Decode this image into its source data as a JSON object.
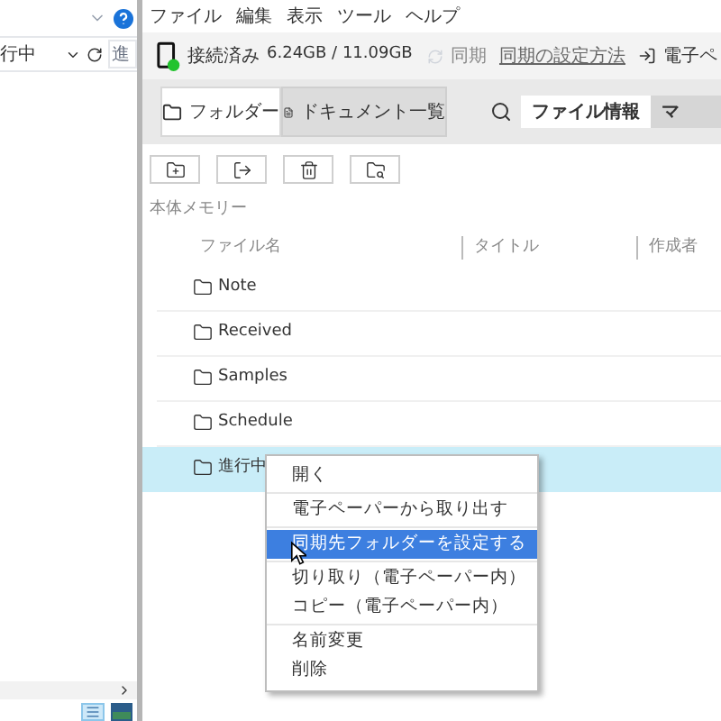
{
  "left_window": {
    "field_value": "行中",
    "input_placeholder": "進"
  },
  "menu_bar": [
    "ファイル",
    "編集",
    "表示",
    "ツール",
    "ヘルプ"
  ],
  "status": {
    "connection": "接続済み",
    "storage": "6.24GB / 11.09GB",
    "sync_label": "同期",
    "sync_disabled": true,
    "sync_help_link": "同期の設定方法",
    "device_button": "電子ペ"
  },
  "view_tabs": [
    {
      "label": "フォルダー",
      "selected": true
    },
    {
      "label": "ドキュメント一覧",
      "selected": false
    }
  ],
  "info_tabs": [
    {
      "label": "ファイル情報",
      "selected": true
    },
    {
      "label": "マ",
      "selected": false
    }
  ],
  "storage_label": "本体メモリー",
  "table": {
    "columns": [
      "ファイル名",
      "タイトル",
      "作成者"
    ],
    "rows": [
      {
        "name": "Note",
        "selected": false
      },
      {
        "name": "Received",
        "selected": false
      },
      {
        "name": "Samples",
        "selected": false
      },
      {
        "name": "Schedule",
        "selected": false
      },
      {
        "name": "進行中",
        "selected": true
      }
    ]
  },
  "context_menu": [
    [
      {
        "label": "開く",
        "selected": false
      }
    ],
    [
      {
        "label": "電子ペーパーから取り出す",
        "selected": false
      }
    ],
    [
      {
        "label": "同期先フォルダーを設定する",
        "selected": true
      }
    ],
    [
      {
        "label": "切り取り（電子ペーパー内）",
        "selected": false
      },
      {
        "label": "コピー（電子ペーパー内）",
        "selected": false
      }
    ],
    [
      {
        "label": "名前変更",
        "selected": false
      },
      {
        "label": "削除",
        "selected": false
      }
    ]
  ]
}
